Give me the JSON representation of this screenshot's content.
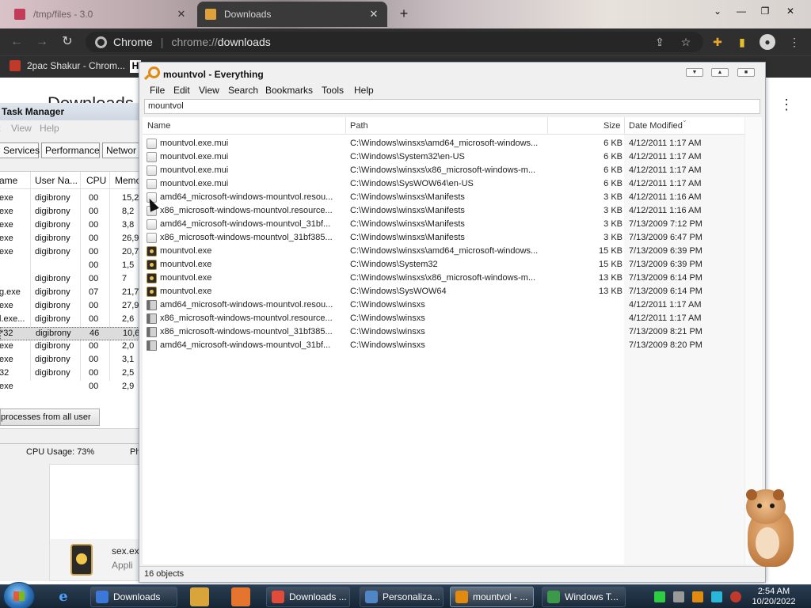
{
  "chrome": {
    "tabs": [
      {
        "label": "/tmp/files - 3.0"
      },
      {
        "label": "Downloads"
      }
    ],
    "omnibox": {
      "site": "Chrome",
      "scheme": "chrome://",
      "path": "downloads"
    },
    "bookmarks": [
      {
        "label": "2pac Shakur - Chrom..."
      }
    ],
    "bookmark_h": "H",
    "page_title_fragment": "Downloads"
  },
  "task_manager": {
    "title": "Task Manager",
    "menu": [
      "View",
      "Help"
    ],
    "tabs": [
      "Services",
      "Performance",
      "Networ"
    ],
    "columns": [
      "ame",
      "User Na...",
      "CPU",
      "Memo"
    ],
    "rows": [
      {
        "image": "exe",
        "user": "digibrony",
        "cpu": "00",
        "mem": "15,2"
      },
      {
        "image": "exe",
        "user": "digibrony",
        "cpu": "00",
        "mem": "8,2"
      },
      {
        "image": "exe",
        "user": "digibrony",
        "cpu": "00",
        "mem": "3,8"
      },
      {
        "image": "exe",
        "user": "digibrony",
        "cpu": "00",
        "mem": "26,9"
      },
      {
        "image": "exe",
        "user": "digibrony",
        "cpu": "00",
        "mem": "20,7"
      },
      {
        "image": "",
        "user": "",
        "cpu": "00",
        "mem": "1,5"
      },
      {
        "image": "",
        "user": "digibrony",
        "cpu": "00",
        "mem": "7"
      },
      {
        "image": "g.exe",
        "user": "digibrony",
        "cpu": "07",
        "mem": "21,7"
      },
      {
        "image": "exe",
        "user": "digibrony",
        "cpu": "00",
        "mem": "27,9"
      },
      {
        "image": "l.exe...",
        "user": "digibrony",
        "cpu": "00",
        "mem": "2,6"
      },
      {
        "image": "*32",
        "user": "digibrony",
        "cpu": "46",
        "mem": "10,6"
      },
      {
        "image": "exe",
        "user": "digibrony",
        "cpu": "00",
        "mem": "2,0"
      },
      {
        "image": "exe",
        "user": "digibrony",
        "cpu": "00",
        "mem": "3,1"
      },
      {
        "image": "32",
        "user": "digibrony",
        "cpu": "00",
        "mem": "2,5"
      },
      {
        "image": "exe",
        "user": "",
        "cpu": "00",
        "mem": "2,9"
      }
    ],
    "show_all_label": "processes from all user",
    "status_cpu": "CPU Usage: 73%",
    "status_ph": "Ph"
  },
  "download_item": {
    "filename": "sex.ex",
    "filetype": "Appli"
  },
  "everything": {
    "title": "mountvol - Everything",
    "menu": [
      "File",
      "Edit",
      "View",
      "Search",
      "Bookmarks",
      "Tools",
      "Help"
    ],
    "search_value": "mountvol",
    "columns": {
      "name": "Name",
      "path": "Path",
      "size": "Size",
      "date": "Date Modified"
    },
    "rows": [
      {
        "icon": "file",
        "name": "mountvol.exe.mui",
        "path": "C:\\Windows\\winsxs\\amd64_microsoft-windows...",
        "size": "6 KB",
        "date": "4/12/2011 1:17 AM"
      },
      {
        "icon": "file",
        "name": "mountvol.exe.mui",
        "path": "C:\\Windows\\System32\\en-US",
        "size": "6 KB",
        "date": "4/12/2011 1:17 AM"
      },
      {
        "icon": "file",
        "name": "mountvol.exe.mui",
        "path": "C:\\Windows\\winsxs\\x86_microsoft-windows-m...",
        "size": "6 KB",
        "date": "4/12/2011 1:17 AM"
      },
      {
        "icon": "file",
        "name": "mountvol.exe.mui",
        "path": "C:\\Windows\\SysWOW64\\en-US",
        "size": "6 KB",
        "date": "4/12/2011 1:17 AM"
      },
      {
        "icon": "file",
        "name": "amd64_microsoft-windows-mountvol.resou...",
        "path": "C:\\Windows\\winsxs\\Manifests",
        "size": "3 KB",
        "date": "4/12/2011 1:16 AM"
      },
      {
        "icon": "file",
        "name": "x86_microsoft-windows-mountvol.resource...",
        "path": "C:\\Windows\\winsxs\\Manifests",
        "size": "3 KB",
        "date": "4/12/2011 1:16 AM"
      },
      {
        "icon": "file",
        "name": "amd64_microsoft-windows-mountvol_31bf...",
        "path": "C:\\Windows\\winsxs\\Manifests",
        "size": "3 KB",
        "date": "7/13/2009 7:12 PM"
      },
      {
        "icon": "file",
        "name": "x86_microsoft-windows-mountvol_31bf385...",
        "path": "C:\\Windows\\winsxs\\Manifests",
        "size": "3 KB",
        "date": "7/13/2009 6:47 PM"
      },
      {
        "icon": "exe",
        "name": "mountvol.exe",
        "path": "C:\\Windows\\winsxs\\amd64_microsoft-windows...",
        "size": "15 KB",
        "date": "7/13/2009 6:39 PM"
      },
      {
        "icon": "exe",
        "name": "mountvol.exe",
        "path": "C:\\Windows\\System32",
        "size": "15 KB",
        "date": "7/13/2009 6:39 PM"
      },
      {
        "icon": "exe",
        "name": "mountvol.exe",
        "path": "C:\\Windows\\winsxs\\x86_microsoft-windows-m...",
        "size": "13 KB",
        "date": "7/13/2009 6:14 PM"
      },
      {
        "icon": "exe",
        "name": "mountvol.exe",
        "path": "C:\\Windows\\SysWOW64",
        "size": "13 KB",
        "date": "7/13/2009 6:14 PM"
      },
      {
        "icon": "folder",
        "name": "amd64_microsoft-windows-mountvol.resou...",
        "path": "C:\\Windows\\winsxs",
        "size": "",
        "date": "4/12/2011 1:17 AM"
      },
      {
        "icon": "folder",
        "name": "x86_microsoft-windows-mountvol.resource...",
        "path": "C:\\Windows\\winsxs",
        "size": "",
        "date": "4/12/2011 1:17 AM"
      },
      {
        "icon": "folder",
        "name": "x86_microsoft-windows-mountvol_31bf385...",
        "path": "C:\\Windows\\winsxs",
        "size": "",
        "date": "7/13/2009 8:21 PM"
      },
      {
        "icon": "folder",
        "name": "amd64_microsoft-windows-mountvol_31bf...",
        "path": "C:\\Windows\\winsxs",
        "size": "",
        "date": "7/13/2009 8:20 PM"
      }
    ],
    "status": "16 objects"
  },
  "taskbar": {
    "buttons": [
      {
        "label": "Downloads",
        "icon": "chrome-icon",
        "icon_color": "#3b78d8"
      },
      {
        "label": "Downloads ...",
        "icon": "chrome-icon",
        "icon_color": "#e04b3a"
      },
      {
        "label": "Personaliza...",
        "icon": "monitor-icon",
        "icon_color": "#4f86c6"
      },
      {
        "label": "mountvol - ...",
        "icon": "search-icon",
        "icon_color": "#e08a10",
        "active": true
      },
      {
        "label": "Windows T...",
        "icon": "taskmgr-icon",
        "icon_color": "#3a9a4a"
      }
    ],
    "clock_time": "2:54 AM",
    "clock_date": "10/20/2022"
  }
}
